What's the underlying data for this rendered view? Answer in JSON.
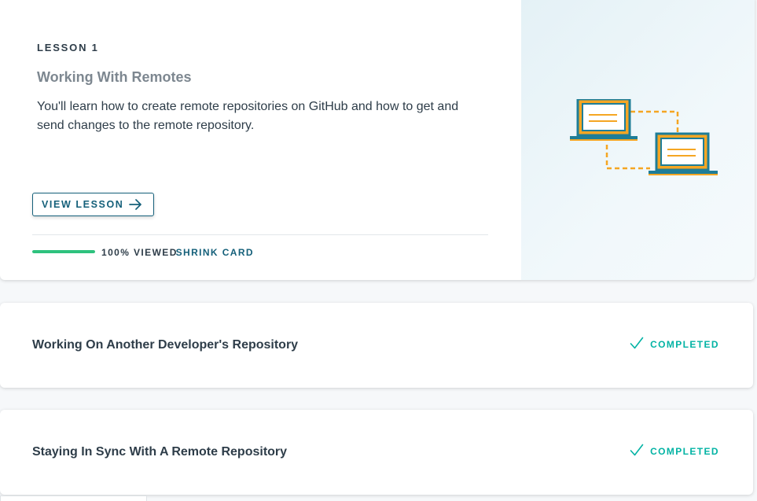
{
  "lesson": {
    "kicker": "LESSON 1",
    "title": "Working With Remotes",
    "description": "You'll learn how to create remote repositories on GitHub and how to get and send changes to the remote repository.",
    "view_label": "VIEW LESSON",
    "progress_percent": 100,
    "progress_label": "100% VIEWED",
    "shrink_label": "SHRINK CARD",
    "illustration_icon": "two-laptops-sync-icon"
  },
  "lessons": [
    {
      "title": "Working On Another Developer's Repository",
      "status": "COMPLETED"
    },
    {
      "title": "Staying In Sync With A Remote Repository",
      "status": "COMPLETED"
    }
  ],
  "colors": {
    "accent": "#15607a",
    "success": "#02b3a4",
    "progress": "#2ec27e",
    "illustration_teal": "#1e7d97",
    "illustration_orange": "#f5a623"
  }
}
